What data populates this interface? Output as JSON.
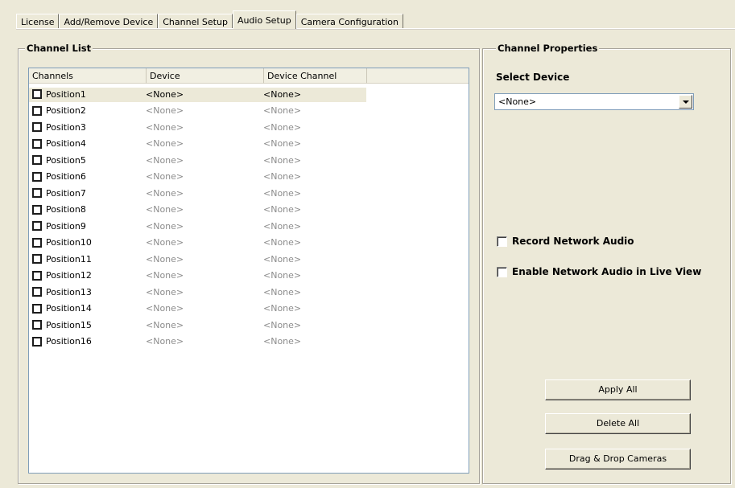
{
  "tabs": [
    {
      "label": "License",
      "active": false
    },
    {
      "label": "Add/Remove Device",
      "active": false
    },
    {
      "label": "Channel Setup",
      "active": false
    },
    {
      "label": "Audio Setup",
      "active": true
    },
    {
      "label": "Camera Configuration",
      "active": false
    }
  ],
  "channel_list": {
    "title": "Channel List",
    "columns": [
      "Channels",
      "Device",
      "Device Channel",
      ""
    ],
    "rows": [
      {
        "channel": "Position1",
        "device": "<None>",
        "device_channel": "<None>",
        "selected": true
      },
      {
        "channel": "Position2",
        "device": "<None>",
        "device_channel": "<None>"
      },
      {
        "channel": "Position3",
        "device": "<None>",
        "device_channel": "<None>"
      },
      {
        "channel": "Position4",
        "device": "<None>",
        "device_channel": "<None>"
      },
      {
        "channel": "Position5",
        "device": "<None>",
        "device_channel": "<None>"
      },
      {
        "channel": "Position6",
        "device": "<None>",
        "device_channel": "<None>"
      },
      {
        "channel": "Position7",
        "device": "<None>",
        "device_channel": "<None>"
      },
      {
        "channel": "Position8",
        "device": "<None>",
        "device_channel": "<None>"
      },
      {
        "channel": "Position9",
        "device": "<None>",
        "device_channel": "<None>"
      },
      {
        "channel": "Position10",
        "device": "<None>",
        "device_channel": "<None>"
      },
      {
        "channel": "Position11",
        "device": "<None>",
        "device_channel": "<None>"
      },
      {
        "channel": "Position12",
        "device": "<None>",
        "device_channel": "<None>"
      },
      {
        "channel": "Position13",
        "device": "<None>",
        "device_channel": "<None>"
      },
      {
        "channel": "Position14",
        "device": "<None>",
        "device_channel": "<None>"
      },
      {
        "channel": "Position15",
        "device": "<None>",
        "device_channel": "<None>"
      },
      {
        "channel": "Position16",
        "device": "<None>",
        "device_channel": "<None>"
      }
    ]
  },
  "channel_properties": {
    "title": "Channel Properties",
    "select_device_label": "Select Device",
    "select_device_value": "<None>",
    "record_network_audio": {
      "label": "Record Network Audio",
      "checked": false
    },
    "enable_network_audio_live": {
      "label": "Enable Network Audio in Live View",
      "checked": false
    },
    "buttons": {
      "apply_all": "Apply All",
      "delete_all": "Delete All",
      "drag_drop": "Drag & Drop Cameras"
    }
  }
}
